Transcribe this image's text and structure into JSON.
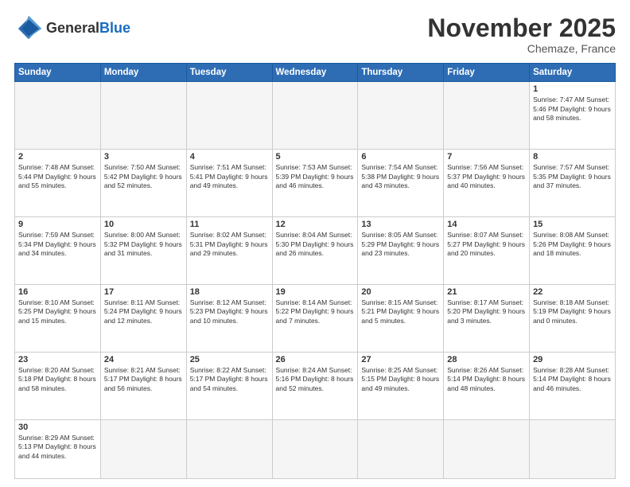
{
  "header": {
    "logo_general": "General",
    "logo_blue": "Blue",
    "month": "November 2025",
    "location": "Chemaze, France"
  },
  "days_of_week": [
    "Sunday",
    "Monday",
    "Tuesday",
    "Wednesday",
    "Thursday",
    "Friday",
    "Saturday"
  ],
  "weeks": [
    [
      {
        "day": "",
        "info": ""
      },
      {
        "day": "",
        "info": ""
      },
      {
        "day": "",
        "info": ""
      },
      {
        "day": "",
        "info": ""
      },
      {
        "day": "",
        "info": ""
      },
      {
        "day": "",
        "info": ""
      },
      {
        "day": "1",
        "info": "Sunrise: 7:47 AM\nSunset: 5:46 PM\nDaylight: 9 hours\nand 58 minutes."
      }
    ],
    [
      {
        "day": "2",
        "info": "Sunrise: 7:48 AM\nSunset: 5:44 PM\nDaylight: 9 hours\nand 55 minutes."
      },
      {
        "day": "3",
        "info": "Sunrise: 7:50 AM\nSunset: 5:42 PM\nDaylight: 9 hours\nand 52 minutes."
      },
      {
        "day": "4",
        "info": "Sunrise: 7:51 AM\nSunset: 5:41 PM\nDaylight: 9 hours\nand 49 minutes."
      },
      {
        "day": "5",
        "info": "Sunrise: 7:53 AM\nSunset: 5:39 PM\nDaylight: 9 hours\nand 46 minutes."
      },
      {
        "day": "6",
        "info": "Sunrise: 7:54 AM\nSunset: 5:38 PM\nDaylight: 9 hours\nand 43 minutes."
      },
      {
        "day": "7",
        "info": "Sunrise: 7:56 AM\nSunset: 5:37 PM\nDaylight: 9 hours\nand 40 minutes."
      },
      {
        "day": "8",
        "info": "Sunrise: 7:57 AM\nSunset: 5:35 PM\nDaylight: 9 hours\nand 37 minutes."
      }
    ],
    [
      {
        "day": "9",
        "info": "Sunrise: 7:59 AM\nSunset: 5:34 PM\nDaylight: 9 hours\nand 34 minutes."
      },
      {
        "day": "10",
        "info": "Sunrise: 8:00 AM\nSunset: 5:32 PM\nDaylight: 9 hours\nand 31 minutes."
      },
      {
        "day": "11",
        "info": "Sunrise: 8:02 AM\nSunset: 5:31 PM\nDaylight: 9 hours\nand 29 minutes."
      },
      {
        "day": "12",
        "info": "Sunrise: 8:04 AM\nSunset: 5:30 PM\nDaylight: 9 hours\nand 26 minutes."
      },
      {
        "day": "13",
        "info": "Sunrise: 8:05 AM\nSunset: 5:29 PM\nDaylight: 9 hours\nand 23 minutes."
      },
      {
        "day": "14",
        "info": "Sunrise: 8:07 AM\nSunset: 5:27 PM\nDaylight: 9 hours\nand 20 minutes."
      },
      {
        "day": "15",
        "info": "Sunrise: 8:08 AM\nSunset: 5:26 PM\nDaylight: 9 hours\nand 18 minutes."
      }
    ],
    [
      {
        "day": "16",
        "info": "Sunrise: 8:10 AM\nSunset: 5:25 PM\nDaylight: 9 hours\nand 15 minutes."
      },
      {
        "day": "17",
        "info": "Sunrise: 8:11 AM\nSunset: 5:24 PM\nDaylight: 9 hours\nand 12 minutes."
      },
      {
        "day": "18",
        "info": "Sunrise: 8:12 AM\nSunset: 5:23 PM\nDaylight: 9 hours\nand 10 minutes."
      },
      {
        "day": "19",
        "info": "Sunrise: 8:14 AM\nSunset: 5:22 PM\nDaylight: 9 hours\nand 7 minutes."
      },
      {
        "day": "20",
        "info": "Sunrise: 8:15 AM\nSunset: 5:21 PM\nDaylight: 9 hours\nand 5 minutes."
      },
      {
        "day": "21",
        "info": "Sunrise: 8:17 AM\nSunset: 5:20 PM\nDaylight: 9 hours\nand 3 minutes."
      },
      {
        "day": "22",
        "info": "Sunrise: 8:18 AM\nSunset: 5:19 PM\nDaylight: 9 hours\nand 0 minutes."
      }
    ],
    [
      {
        "day": "23",
        "info": "Sunrise: 8:20 AM\nSunset: 5:18 PM\nDaylight: 8 hours\nand 58 minutes."
      },
      {
        "day": "24",
        "info": "Sunrise: 8:21 AM\nSunset: 5:17 PM\nDaylight: 8 hours\nand 56 minutes."
      },
      {
        "day": "25",
        "info": "Sunrise: 8:22 AM\nSunset: 5:17 PM\nDaylight: 8 hours\nand 54 minutes."
      },
      {
        "day": "26",
        "info": "Sunrise: 8:24 AM\nSunset: 5:16 PM\nDaylight: 8 hours\nand 52 minutes."
      },
      {
        "day": "27",
        "info": "Sunrise: 8:25 AM\nSunset: 5:15 PM\nDaylight: 8 hours\nand 49 minutes."
      },
      {
        "day": "28",
        "info": "Sunrise: 8:26 AM\nSunset: 5:14 PM\nDaylight: 8 hours\nand 48 minutes."
      },
      {
        "day": "29",
        "info": "Sunrise: 8:28 AM\nSunset: 5:14 PM\nDaylight: 8 hours\nand 46 minutes."
      }
    ],
    [
      {
        "day": "30",
        "info": "Sunrise: 8:29 AM\nSunset: 5:13 PM\nDaylight: 8 hours\nand 44 minutes."
      },
      {
        "day": "",
        "info": ""
      },
      {
        "day": "",
        "info": ""
      },
      {
        "day": "",
        "info": ""
      },
      {
        "day": "",
        "info": ""
      },
      {
        "day": "",
        "info": ""
      },
      {
        "day": "",
        "info": ""
      }
    ]
  ]
}
